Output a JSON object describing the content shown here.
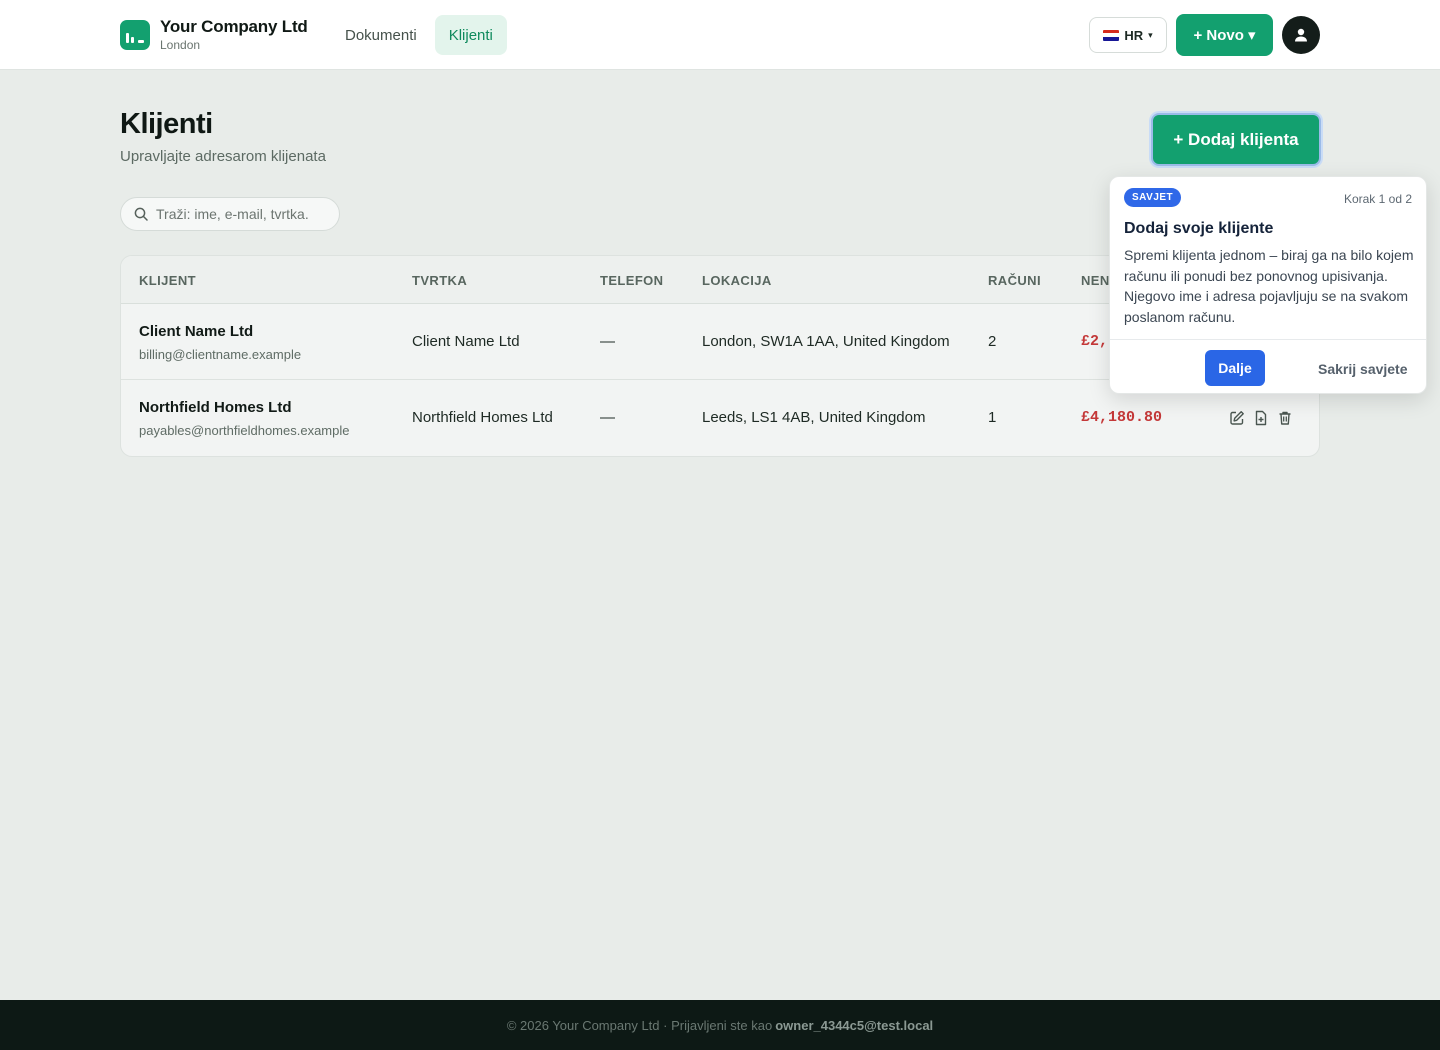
{
  "header": {
    "company_name": "Your Company Ltd",
    "company_city": "London",
    "nav": [
      {
        "label": "Dokumenti",
        "active": false
      },
      {
        "label": "Klijenti",
        "active": true
      }
    ],
    "language": "HR",
    "new_button": "+ Novo ▾"
  },
  "page": {
    "title": "Klijenti",
    "subtitle": "Upravljajte adresarom klijenata",
    "add_button": "+ Dodaj klijenta"
  },
  "search": {
    "placeholder": "Traži: ime, e-mail, tvrtka."
  },
  "table": {
    "columns": [
      "KLIJENT",
      "TVRTKA",
      "TELEFON",
      "LOKACIJA",
      "RAČUNI",
      "NEN"
    ],
    "rows": [
      {
        "name": "Client Name Ltd",
        "email": "billing@clientname.example",
        "company": "Client Name Ltd",
        "phone": "—",
        "location": "London, SW1A 1AA, United Kingdom",
        "invoices": "2",
        "unpaid": "£2,"
      },
      {
        "name": "Northfield Homes Ltd",
        "email": "payables@northfieldhomes.example",
        "company": "Northfield Homes Ltd",
        "phone": "—",
        "location": "Leeds, LS1 4AB, United Kingdom",
        "invoices": "1",
        "unpaid": "£4,180.80"
      }
    ]
  },
  "tip": {
    "badge": "SAVJET",
    "step": "Korak 1 od 2",
    "title": "Dodaj svoje klijente",
    "body": "Spremi klijenta jednom – biraj ga na bilo kojem računu ili ponudi bez ponovnog upisivanja. Njegovo ime i adresa pojavljuju se na svakom poslanom računu.",
    "next": "Dalje",
    "hide": "Sakrij savjete"
  },
  "footer": {
    "text": "© 2026 Your Company Ltd · Prijavljeni ste kao",
    "user": "owner_4344c5@test.local"
  },
  "colors": {
    "brand_green": "#13a06f",
    "accent_blue": "#2a66e6",
    "amount_red": "#c43838",
    "footer_bg": "#0d1915"
  }
}
